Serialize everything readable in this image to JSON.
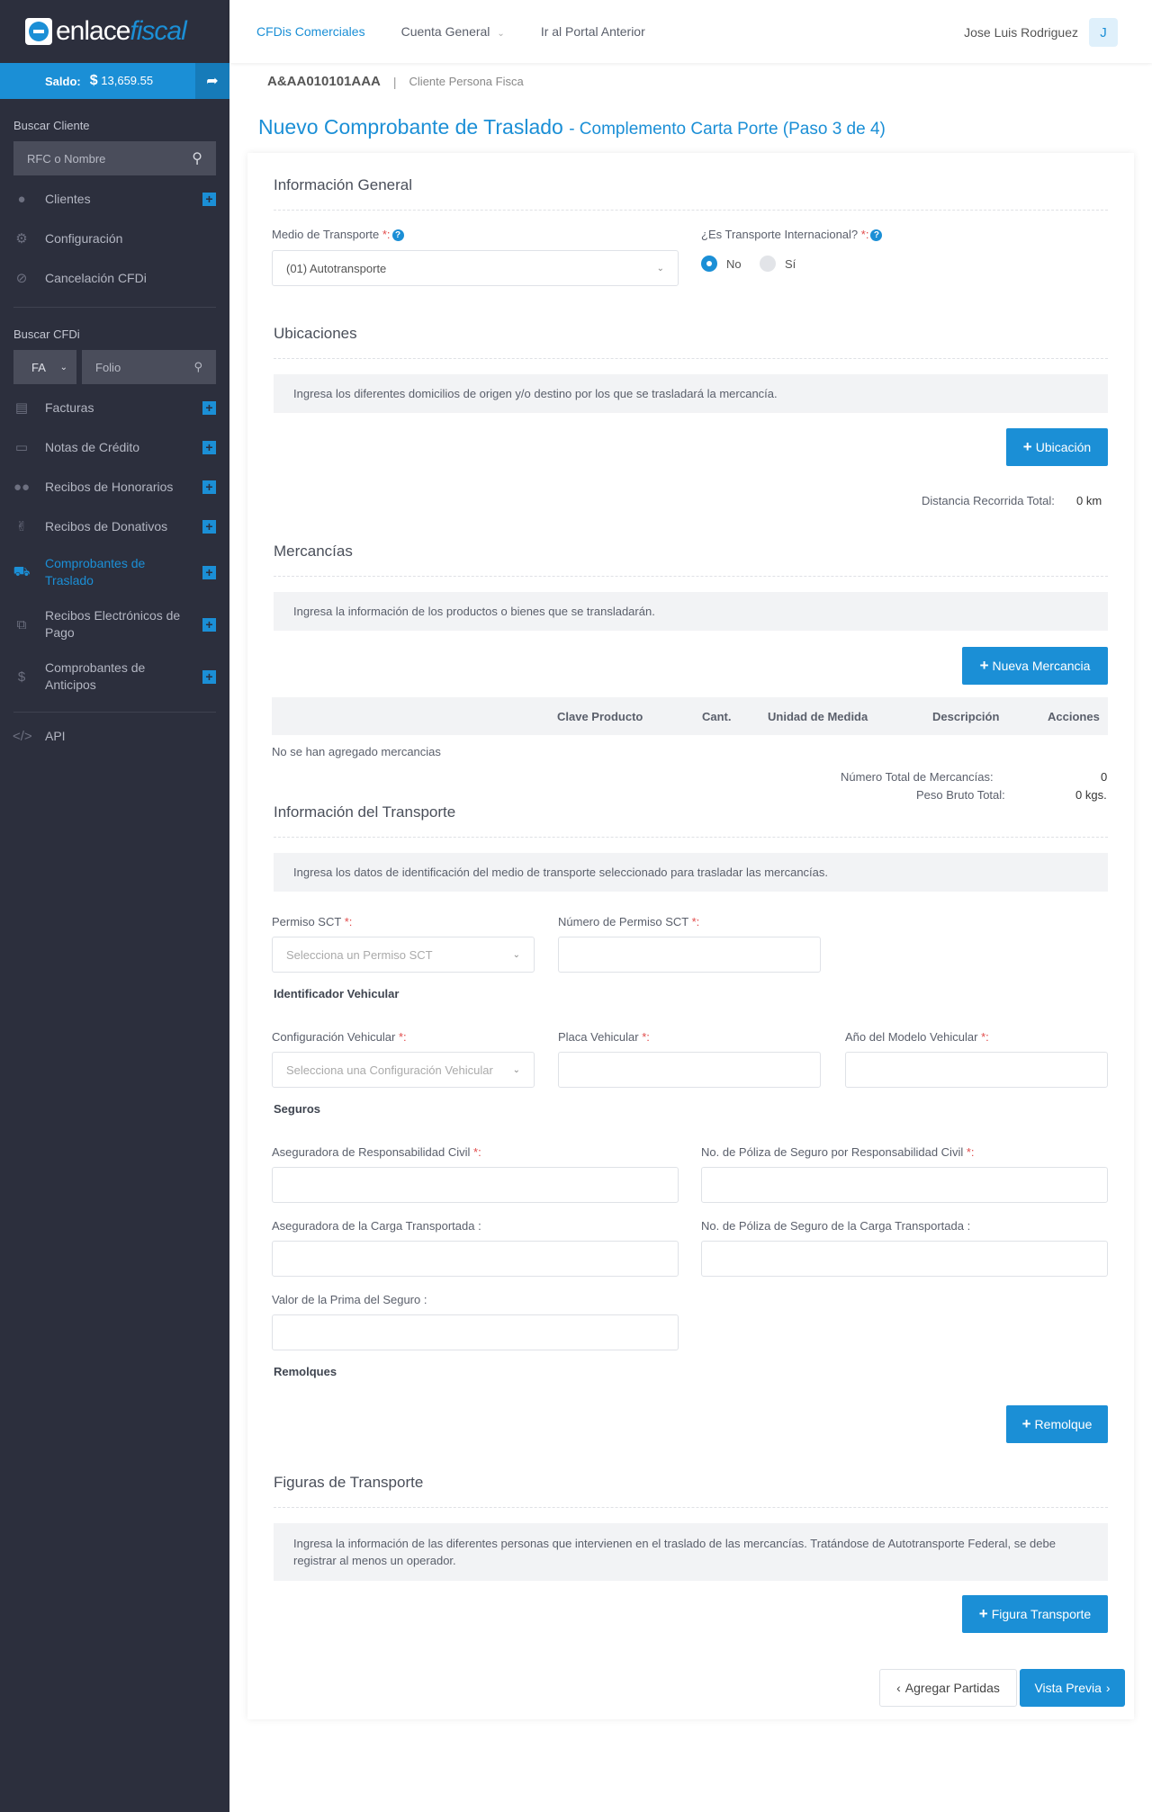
{
  "sidebar": {
    "logo": {
      "enlace": "enlace",
      "fiscal": "fiscal"
    },
    "saldo_label": "Saldo:",
    "saldo_currency": "$",
    "saldo_value": "13,659.55",
    "buscar_cliente_heading": "Buscar Cliente",
    "buscar_cliente_placeholder": "RFC o Nombre",
    "items_top": [
      {
        "label": "Clientes"
      },
      {
        "label": "Configuración"
      },
      {
        "label": "Cancelación CFDi"
      }
    ],
    "buscar_cfdi_heading": "Buscar CFDi",
    "cfdi_series": "FA",
    "cfdi_folio_placeholder": "Folio",
    "items_cfdi": [
      {
        "label": "Facturas"
      },
      {
        "label": "Notas de Crédito"
      },
      {
        "label": "Recibos de Honorarios"
      },
      {
        "label": "Recibos de Donativos"
      },
      {
        "label": "Comprobantes de Traslado"
      },
      {
        "label": "Recibos Electrónicos de Pago"
      },
      {
        "label": "Comprobantes de Anticipos"
      }
    ],
    "api_label": "API"
  },
  "topbar": {
    "nav": [
      "CFDis Comerciales",
      "Cuenta General",
      "Ir al Portal Anterior"
    ],
    "user_name": "Jose Luis Rodriguez",
    "avatar_letter": "J"
  },
  "header": {
    "rfc": "A&AA010101AAA",
    "separator": "|",
    "client_type": "Cliente Persona Fisca",
    "title": "Nuevo Comprobante de Traslado",
    "subtitle": "- Complemento Carta Porte (Paso 3 de 4)"
  },
  "general": {
    "title": "Información General",
    "medio_label": "Medio de Transporte",
    "medio_value": "(01) Autotransporte",
    "intl_label": "¿Es Transporte Internacional?",
    "radio_no": "No",
    "radio_si": "Sí"
  },
  "ubicaciones": {
    "title": "Ubicaciones",
    "info": "Ingresa los diferentes domicilios de origen y/o destino por los que se trasladará la mercancía.",
    "button": "Ubicación",
    "distancia_label": "Distancia Recorrida Total:",
    "distancia_value": "0 km"
  },
  "mercancias": {
    "title": "Mercancías",
    "info": "Ingresa la información de los productos o bienes que se transladarán.",
    "button": "Nueva Mercancia",
    "columns": [
      "Clave Producto",
      "Cant.",
      "Unidad de Medida",
      "Descripción",
      "Acciones"
    ],
    "empty": "No se han agregado mercancias",
    "total_label": "Número Total de Mercancías:",
    "total_value": "0",
    "peso_label": "Peso Bruto Total:",
    "peso_value": "0 kgs."
  },
  "transporte": {
    "title": "Información del Transporte",
    "info": "Ingresa los datos de identificación del medio de transporte seleccionado para trasladar las mercancías.",
    "permiso_label": "Permiso SCT",
    "permiso_placeholder": "Selecciona un Permiso SCT",
    "num_permiso_label": "Número de Permiso SCT",
    "identificador_heading": "Identificador Vehicular",
    "config_label": "Configuración Vehicular",
    "config_placeholder": "Selecciona una Configuración Vehicular",
    "placa_label": "Placa Vehicular",
    "anio_label": "Año del Modelo Vehicular",
    "seguros_heading": "Seguros",
    "aseg_civil_label": "Aseguradora de Responsabilidad Civil",
    "poliza_civil_label": "No. de Póliza de Seguro por Responsabilidad Civil",
    "aseg_carga_label": "Aseguradora de la Carga Transportada :",
    "poliza_carga_label": "No. de Póliza de Seguro de la Carga Transportada :",
    "prima_label": "Valor de la Prima del Seguro :",
    "remolques_heading": "Remolques",
    "remolque_button": "Remolque"
  },
  "figuras": {
    "title": "Figuras de Transporte",
    "info": "Ingresa la información de las diferentes personas que intervienen en el traslado de las mercancías. Tratándose de Autotransporte Federal, se debe registrar al menos un operador.",
    "button": "Figura Transporte"
  },
  "footer": {
    "back": "Agregar Partidas",
    "next": "Vista Previa"
  },
  "required_mark": "*:",
  "colors": {
    "accent": "#1b8fd6",
    "sidebar": "#2c2f3d",
    "required": "#e14b4b"
  }
}
